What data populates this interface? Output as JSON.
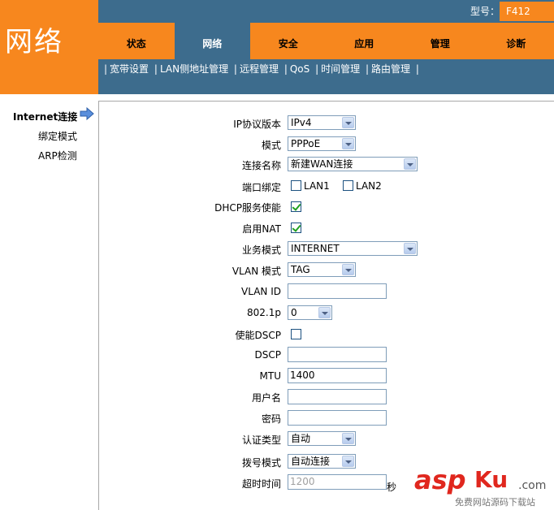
{
  "brand": {
    "title": "网络"
  },
  "header": {
    "model_label": "型号：",
    "model_value": "F412"
  },
  "tabs": [
    {
      "label": "状态"
    },
    {
      "label": "网络"
    },
    {
      "label": "安全"
    },
    {
      "label": "应用"
    },
    {
      "label": "管理"
    },
    {
      "label": "诊断"
    }
  ],
  "active_tab": "网络",
  "subnav": [
    "宽带设置",
    "LAN侧地址管理",
    "远程管理",
    "QoS",
    "时间管理",
    "路由管理"
  ],
  "sidebar": {
    "items": [
      {
        "label": "Internet连接"
      },
      {
        "label": "绑定模式"
      },
      {
        "label": "ARP检测"
      }
    ]
  },
  "form": {
    "ip_version": {
      "label": "IP协议版本",
      "value": "IPv4"
    },
    "mode": {
      "label": "模式",
      "value": "PPPoE"
    },
    "connection_name": {
      "label": "连接名称",
      "value": "新建WAN连接"
    },
    "port_binding": {
      "label": "端口绑定",
      "lan1": "LAN1",
      "lan2": "LAN2",
      "lan1_checked": false,
      "lan2_checked": false
    },
    "dhcp_enable": {
      "label": "DHCP服务使能",
      "checked": true
    },
    "nat_enable": {
      "label": "启用NAT",
      "checked": true
    },
    "service_mode": {
      "label": "业务模式",
      "value": "INTERNET"
    },
    "vlan_mode": {
      "label": "VLAN 模式",
      "value": "TAG"
    },
    "vlan_id": {
      "label": "VLAN ID",
      "value": ""
    },
    "dot1p": {
      "label": "802.1p",
      "value": "0"
    },
    "dscp_enable": {
      "label": "使能DSCP",
      "checked": false
    },
    "dscp": {
      "label": "DSCP",
      "value": ""
    },
    "mtu": {
      "label": "MTU",
      "value": "1400"
    },
    "username": {
      "label": "用户名",
      "value": ""
    },
    "password": {
      "label": "密码",
      "value": ""
    },
    "auth_type": {
      "label": "认证类型",
      "value": "自动"
    },
    "dial_mode": {
      "label": "拨号模式",
      "value": "自动连接"
    },
    "timeout": {
      "label": "超时时间",
      "value": "1200",
      "unit": "秒"
    }
  },
  "watermark": {
    "asp": "asp",
    "ku": "Ku",
    "com": ".com",
    "sub": "免费网站源码下载站"
  },
  "colors": {
    "orange": "#f7871e",
    "blue": "#3d6c8d"
  }
}
